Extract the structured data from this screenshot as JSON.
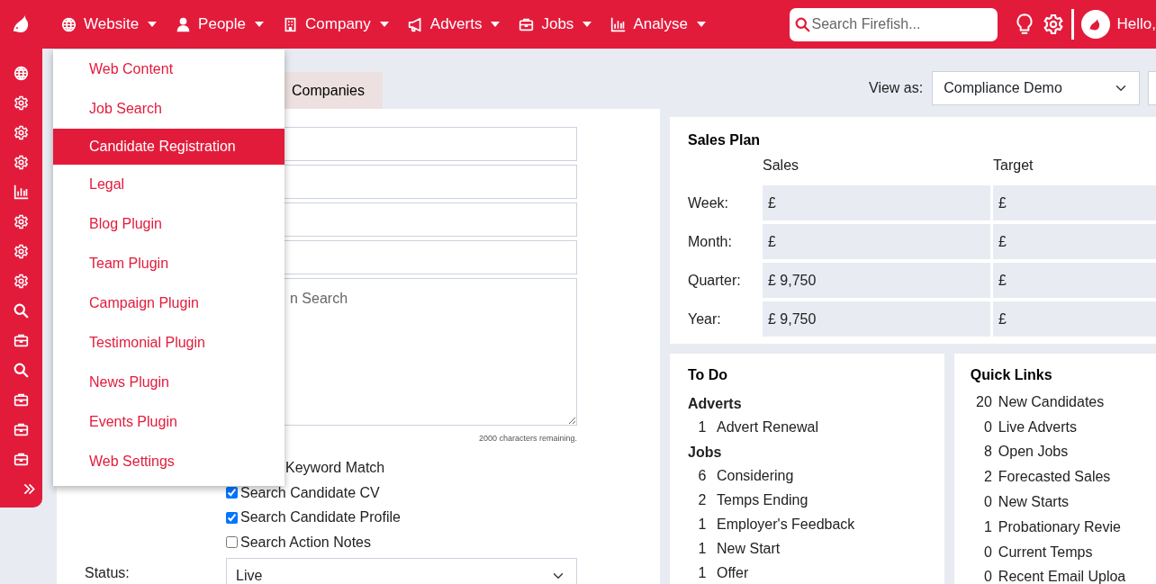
{
  "nav": {
    "menus": [
      {
        "label": "Website"
      },
      {
        "label": "People"
      },
      {
        "label": "Company"
      },
      {
        "label": "Adverts"
      },
      {
        "label": "Jobs"
      },
      {
        "label": "Analyse"
      }
    ],
    "search": {
      "placeholder": "Search Firefish..."
    },
    "greeting": "Hello,"
  },
  "dropdown": {
    "items": [
      {
        "label": "Web Content",
        "selected": false
      },
      {
        "label": "Job Search",
        "selected": false
      },
      {
        "label": "Candidate Registration",
        "selected": true
      },
      {
        "label": "Legal",
        "selected": false
      },
      {
        "label": "Blog Plugin",
        "selected": false
      },
      {
        "label": "Team Plugin",
        "selected": false
      },
      {
        "label": "Campaign Plugin",
        "selected": false
      },
      {
        "label": "Testimonial Plugin",
        "selected": false
      },
      {
        "label": "News Plugin",
        "selected": false
      },
      {
        "label": "Events Plugin",
        "selected": false
      },
      {
        "label": "Web Settings",
        "selected": false
      }
    ]
  },
  "tabs": [
    {
      "label": "Companies",
      "selected": false
    }
  ],
  "form": {
    "textarea": {
      "placeholder": "n Search"
    },
    "counter": "2000 characters remaining.",
    "options": [
      {
        "label": "Keyword Match"
      },
      {
        "label": "Search Candidate CV",
        "checked": true
      },
      {
        "label": "Search Candidate Profile",
        "checked": true
      },
      {
        "label": "Search Action Notes",
        "checked": false
      }
    ],
    "status": {
      "label": "Status:",
      "value": "Live"
    }
  },
  "view_as": {
    "label": "View as:",
    "value": "Compliance Demo"
  },
  "sales_plan": {
    "title": "Sales Plan",
    "columns": [
      "Sales",
      "Target"
    ],
    "rows": [
      {
        "label": "Week:",
        "sales": "£",
        "target": "£"
      },
      {
        "label": "Month:",
        "sales": "£",
        "target": "£"
      },
      {
        "label": "Quarter:",
        "sales": "£ 9,750",
        "target": "£"
      },
      {
        "label": "Year:",
        "sales": "£ 9,750",
        "target": "£"
      }
    ]
  },
  "todo": {
    "title": "To Do",
    "groups": [
      {
        "heading": "Adverts",
        "items": [
          {
            "count": "1",
            "label": "Advert Renewal"
          }
        ]
      },
      {
        "heading": "Jobs",
        "items": [
          {
            "count": "6",
            "label": "Considering"
          },
          {
            "count": "2",
            "label": "Temps Ending"
          },
          {
            "count": "1",
            "label": "Employer's Feedback"
          },
          {
            "count": "1",
            "label": "New Start"
          },
          {
            "count": "1",
            "label": "Offer"
          }
        ]
      }
    ]
  },
  "quick_links": {
    "title": "Quick Links",
    "items": [
      {
        "count": "20",
        "label": "New Candidates"
      },
      {
        "count": "0",
        "label": "Live Adverts"
      },
      {
        "count": "8",
        "label": "Open Jobs"
      },
      {
        "count": "2",
        "label": "Forecasted Sales"
      },
      {
        "count": "0",
        "label": "New Starts"
      },
      {
        "count": "1",
        "label": "Probationary Revie"
      },
      {
        "count": "0",
        "label": "Current Temps"
      },
      {
        "count": "0",
        "label": "Recent Email Uploa"
      }
    ]
  }
}
